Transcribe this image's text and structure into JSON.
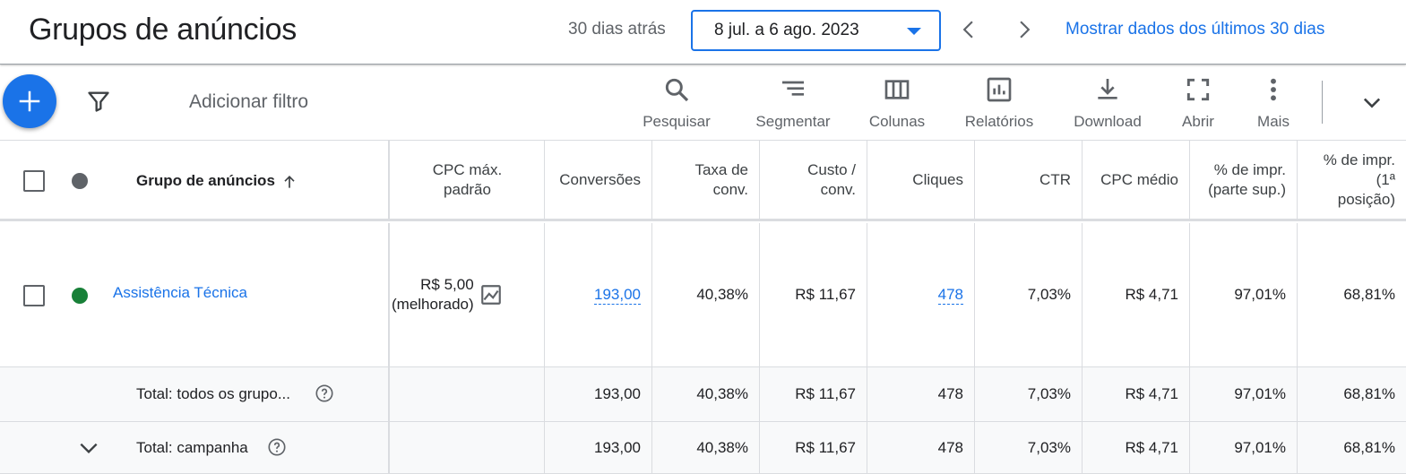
{
  "header": {
    "title": "Grupos de anúncios",
    "date_label": "30 dias atrás",
    "date_range": "8 jul. a 6 ago. 2023",
    "show_link": "Mostrar dados dos últimos 30 dias"
  },
  "toolbar": {
    "add_filter": "Adicionar filtro",
    "tools": [
      {
        "label": "Pesquisar",
        "icon": "search-icon"
      },
      {
        "label": "Segmentar",
        "icon": "segment-icon"
      },
      {
        "label": "Colunas",
        "icon": "columns-icon"
      },
      {
        "label": "Relatórios",
        "icon": "reports-icon"
      },
      {
        "label": "Download",
        "icon": "download-icon"
      },
      {
        "label": "Abrir",
        "icon": "fullscreen-icon"
      },
      {
        "label": "Mais",
        "icon": "more-vert-icon"
      }
    ]
  },
  "table": {
    "columns": {
      "group": "Grupo de anúncios",
      "cpc_max_1": "CPC máx.",
      "cpc_max_2": "padrão",
      "conversions": "Conversões",
      "conv_rate_1": "Taxa de",
      "conv_rate_2": "conv.",
      "cost_conv_1": "Custo /",
      "cost_conv_2": "conv.",
      "clicks": "Cliques",
      "ctr": "CTR",
      "avg_cpc": "CPC médio",
      "impr_top_1": "% de impr.",
      "impr_top_2": "(parte sup.)",
      "impr_abs_1": "% de impr.",
      "impr_abs_2": "(1ª",
      "impr_abs_3": "posição)"
    },
    "rows": [
      {
        "name": "Assistência Técnica",
        "status_color": "#188038",
        "cpc_1": "R$ 5,00",
        "cpc_2": "(melhorado)",
        "conversions": "193,00",
        "conv_rate": "40,38%",
        "cost_conv": "R$ 11,67",
        "clicks": "478",
        "ctr": "7,03%",
        "avg_cpc": "R$ 4,71",
        "impr_top": "97,01%",
        "impr_abs": "68,81%"
      }
    ],
    "totals": [
      {
        "label": "Total: todos os grupo...",
        "conversions": "193,00",
        "conv_rate": "40,38%",
        "cost_conv": "R$ 11,67",
        "clicks": "478",
        "ctr": "7,03%",
        "avg_cpc": "R$ 4,71",
        "impr_top": "97,01%",
        "impr_abs": "68,81%"
      },
      {
        "label": "Total: campanha",
        "conversions": "193,00",
        "conv_rate": "40,38%",
        "cost_conv": "R$ 11,67",
        "clicks": "478",
        "ctr": "7,03%",
        "avg_cpc": "R$ 4,71",
        "impr_top": "97,01%",
        "impr_abs": "68,81%"
      }
    ]
  },
  "colors": {
    "accent": "#1a73e8",
    "status_enabled": "#188038",
    "status_header": "#5f6368"
  }
}
